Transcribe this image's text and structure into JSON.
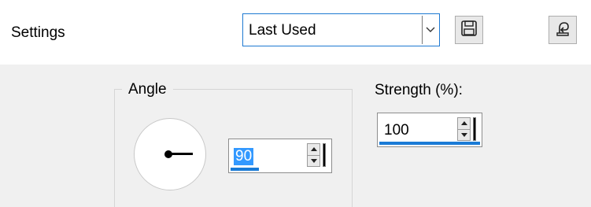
{
  "toolbar": {
    "settings_label": "Settings",
    "preset_value": "Last Used",
    "save_icon": "save-preset-icon",
    "reset_icon": "reset-to-default-icon"
  },
  "angle": {
    "legend": "Angle",
    "value": "90"
  },
  "strength": {
    "label": "Strength (%):",
    "value": "100"
  },
  "colors": {
    "accent": "#1e79d2",
    "selection": "#3399ff",
    "panel_bg": "#f0f0f0"
  }
}
